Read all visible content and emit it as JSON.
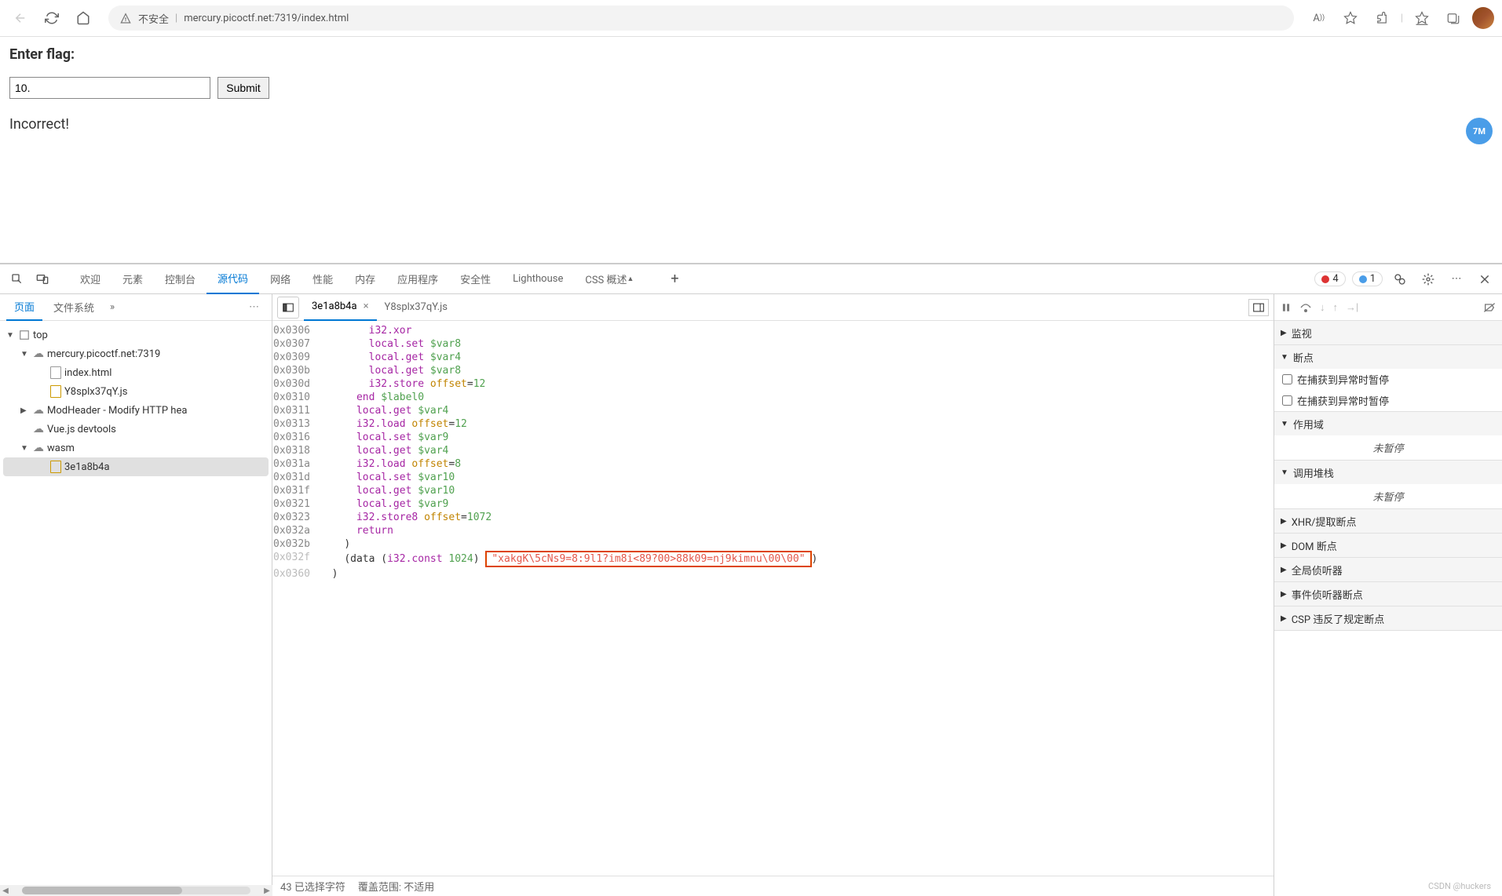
{
  "browser": {
    "security_text": "不安全",
    "url": "mercury.picoctf.net:7319/index.html",
    "side_badge": "7M"
  },
  "page": {
    "heading": "Enter flag:",
    "input_value": "10.",
    "submit_label": "Submit",
    "result": "Incorrect!"
  },
  "devtools": {
    "tabs": [
      "欢迎",
      "元素",
      "控制台",
      "源代码",
      "网络",
      "性能",
      "内存",
      "应用程序",
      "安全性",
      "Lighthouse",
      "CSS 概述"
    ],
    "active_tab": 3,
    "error_count": "4",
    "info_count": "1"
  },
  "left_panel": {
    "tabs": [
      "页面",
      "文件系统"
    ],
    "active": 0,
    "more": "»",
    "tree": {
      "top": "top",
      "site": "mercury.picoctf.net:7319",
      "files": [
        "index.html",
        "Y8splx37qY.js"
      ],
      "ext1": "ModHeader - Modify HTTP hea",
      "ext2": "Vue.js devtools",
      "wasm": "wasm",
      "wasm_file": "3e1a8b4a"
    }
  },
  "center": {
    "tab1": "3e1a8b4a",
    "tab2": "Y8splx37qY.js",
    "status_sel": "43 已选择字符",
    "status_cov": "覆盖范围: 不适用",
    "code": [
      {
        "a": "0x0306",
        "i": 4,
        "p": [
          [
            "kw",
            "i32.xor"
          ]
        ]
      },
      {
        "a": "0x0307",
        "i": 4,
        "p": [
          [
            "kw",
            "local.set"
          ],
          [
            "t",
            " "
          ],
          [
            "var",
            "$var8"
          ]
        ]
      },
      {
        "a": "0x0309",
        "i": 4,
        "p": [
          [
            "kw",
            "local.get"
          ],
          [
            "t",
            " "
          ],
          [
            "var",
            "$var4"
          ]
        ]
      },
      {
        "a": "0x030b",
        "i": 4,
        "p": [
          [
            "kw",
            "local.get"
          ],
          [
            "t",
            " "
          ],
          [
            "var",
            "$var8"
          ]
        ]
      },
      {
        "a": "0x030d",
        "i": 4,
        "p": [
          [
            "kw",
            "i32.store"
          ],
          [
            "t",
            " "
          ],
          [
            "fn",
            "offset"
          ],
          [
            "t",
            "="
          ],
          [
            "num",
            "12"
          ]
        ]
      },
      {
        "a": "0x0310",
        "i": 3,
        "p": [
          [
            "kw",
            "end"
          ],
          [
            "t",
            " "
          ],
          [
            "var",
            "$label0"
          ]
        ]
      },
      {
        "a": "0x0311",
        "i": 3,
        "p": [
          [
            "kw",
            "local.get"
          ],
          [
            "t",
            " "
          ],
          [
            "var",
            "$var4"
          ]
        ]
      },
      {
        "a": "0x0313",
        "i": 3,
        "p": [
          [
            "kw",
            "i32.load"
          ],
          [
            "t",
            " "
          ],
          [
            "fn",
            "offset"
          ],
          [
            "t",
            "="
          ],
          [
            "num",
            "12"
          ]
        ]
      },
      {
        "a": "0x0316",
        "i": 3,
        "p": [
          [
            "kw",
            "local.set"
          ],
          [
            "t",
            " "
          ],
          [
            "var",
            "$var9"
          ]
        ]
      },
      {
        "a": "0x0318",
        "i": 3,
        "p": [
          [
            "kw",
            "local.get"
          ],
          [
            "t",
            " "
          ],
          [
            "var",
            "$var4"
          ]
        ]
      },
      {
        "a": "0x031a",
        "i": 3,
        "p": [
          [
            "kw",
            "i32.load"
          ],
          [
            "t",
            " "
          ],
          [
            "fn",
            "offset"
          ],
          [
            "t",
            "="
          ],
          [
            "num",
            "8"
          ]
        ]
      },
      {
        "a": "0x031d",
        "i": 3,
        "p": [
          [
            "kw",
            "local.set"
          ],
          [
            "t",
            " "
          ],
          [
            "var",
            "$var10"
          ]
        ]
      },
      {
        "a": "0x031f",
        "i": 3,
        "p": [
          [
            "kw",
            "local.get"
          ],
          [
            "t",
            " "
          ],
          [
            "var",
            "$var10"
          ]
        ]
      },
      {
        "a": "0x0321",
        "i": 3,
        "p": [
          [
            "kw",
            "local.get"
          ],
          [
            "t",
            " "
          ],
          [
            "var",
            "$var9"
          ]
        ]
      },
      {
        "a": "0x0323",
        "i": 3,
        "p": [
          [
            "kw",
            "i32.store8"
          ],
          [
            "t",
            " "
          ],
          [
            "fn",
            "offset"
          ],
          [
            "t",
            "="
          ],
          [
            "num",
            "1072"
          ]
        ]
      },
      {
        "a": "0x032a",
        "i": 3,
        "p": [
          [
            "kw",
            "return"
          ]
        ]
      },
      {
        "a": "0x032b",
        "i": 2,
        "p": [
          [
            "t",
            ")"
          ]
        ]
      }
    ],
    "data_line": {
      "a": "0x032f",
      "prefix": "(data (",
      "kw": "i32.const",
      "num": "1024",
      "mid": ") ",
      "str": "\"xakgK\\5cNs9=8:9l1?im8i<89?00>88k09=nj9kimnu\\00\\00\"",
      "suffix": ")"
    },
    "last_line": {
      "a": "0x0360",
      "t": ")"
    }
  },
  "right_panel": {
    "sections": {
      "watch": "监视",
      "breakpoints": "断点",
      "bp1": "在捕获到异常时暂停",
      "bp2": "在捕获到异常时暂停",
      "scope": "作用域",
      "scope_empty": "未暂停",
      "callstack": "调用堆栈",
      "cs_empty": "未暂停",
      "xhr": "XHR/提取断点",
      "dom": "DOM 断点",
      "global": "全局侦听器",
      "event": "事件侦听器断点",
      "csp": "CSP 违反了规定断点"
    }
  },
  "watermark": "CSDN @huckers"
}
